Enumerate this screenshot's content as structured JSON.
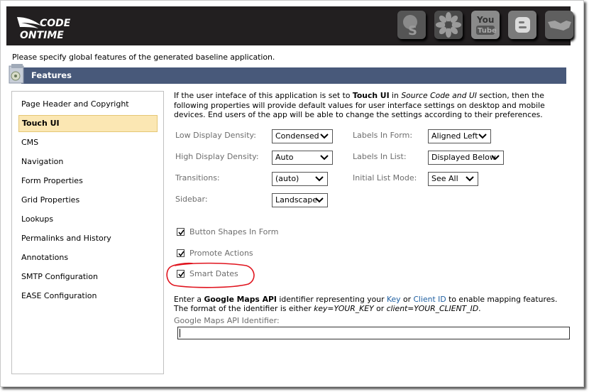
{
  "header": {
    "logo_text_line1": "CODE",
    "logo_text_line2": "ONTIME",
    "social_icons": [
      {
        "name": "stumbleupon-icon",
        "glyph": "S"
      },
      {
        "name": "flower-icon",
        "glyph": ""
      },
      {
        "name": "youtube-icon",
        "glyph_top": "You",
        "glyph_bottom": "Tube"
      },
      {
        "name": "blogger-icon",
        "glyph": "B"
      },
      {
        "name": "handshake-icon",
        "glyph": ""
      }
    ]
  },
  "intro_text": "Please specify global features of the generated baseline application.",
  "section": {
    "title": "Features"
  },
  "sidebar": {
    "items": [
      {
        "label": "Page Header and Copyright",
        "active": false
      },
      {
        "label": "Touch UI",
        "active": true
      },
      {
        "label": "CMS",
        "active": false
      },
      {
        "label": "Navigation",
        "active": false
      },
      {
        "label": "Form Properties",
        "active": false
      },
      {
        "label": "Grid Properties",
        "active": false
      },
      {
        "label": "Lookups",
        "active": false
      },
      {
        "label": "Permalinks and History",
        "active": false
      },
      {
        "label": "Annotations",
        "active": false
      },
      {
        "label": "SMTP Configuration",
        "active": false
      },
      {
        "label": "EASE Configuration",
        "active": false
      }
    ]
  },
  "description": {
    "part1": "If the user inteface of this application is set to ",
    "bold": "Touch UI",
    "part2": " in ",
    "italic": "Source Code and UI",
    "part3": " section, then the following properties will provide default values for user interface settings on desktop and mobile devices. End users of the app will be able to change the settings according to their preferences."
  },
  "settings": {
    "low_density": {
      "label": "Low Display Density:",
      "value": "Condensed"
    },
    "high_density": {
      "label": "High Display Density:",
      "value": "Auto"
    },
    "transitions": {
      "label": "Transitions:",
      "value": "(auto)"
    },
    "sidebar": {
      "label": "Sidebar:",
      "value": "Landscape"
    },
    "labels_in_form": {
      "label": "Labels In Form:",
      "value": "Aligned Left"
    },
    "labels_in_list": {
      "label": "Labels In List:",
      "value": "Displayed Below"
    },
    "initial_list_mode": {
      "label": "Initial List Mode:",
      "value": "See All"
    }
  },
  "checkboxes": [
    {
      "label": "Button Shapes In Form",
      "checked": true
    },
    {
      "label": "Promote Actions",
      "checked": true
    },
    {
      "label": "Smart Dates",
      "checked": true
    }
  ],
  "maps": {
    "d1": "Enter a ",
    "d_bold": "Google Maps API",
    "d2": " identifier representing your ",
    "link_key": "Key",
    "d3": " or ",
    "link_client": "Client ID",
    "d4": " to enable mapping features. The format of the identifier is either ",
    "i1": "key=YOUR_KEY",
    "d5": " or ",
    "i2": "client=YOUR_CLIENT_ID",
    "d6": ".",
    "field_label": "Google Maps API Identifier:",
    "field_value": ""
  },
  "colors": {
    "header_bg": "#221f20",
    "section_bar": "#48597a",
    "active_item_bg": "#fbe7b3",
    "link": "#1f5fa0",
    "annotation": "#e0141e"
  }
}
